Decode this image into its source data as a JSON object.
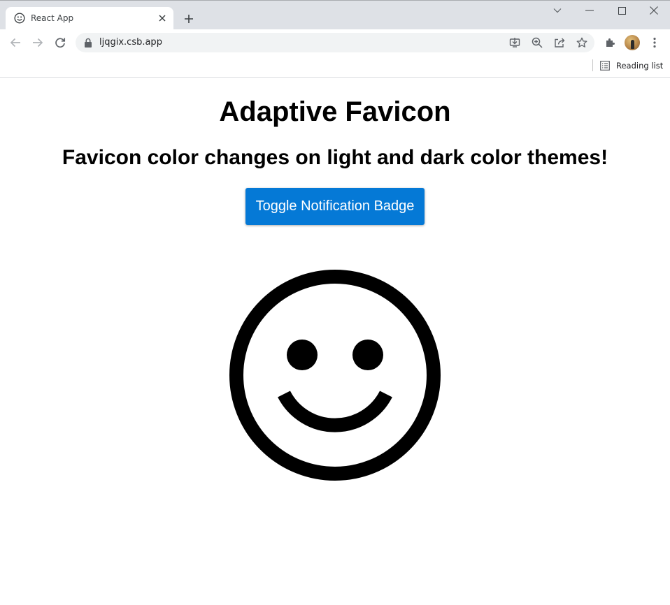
{
  "browser": {
    "tab": {
      "title": "React App",
      "favicon": "smiley-icon",
      "close_icon": "close-icon"
    },
    "new_tab_icon": "plus-icon",
    "window_controls": [
      "chevron-down-icon",
      "minimize-icon",
      "maximize-icon",
      "close-icon"
    ],
    "toolbar": {
      "back_icon": "back-arrow-icon",
      "forward_icon": "forward-arrow-icon",
      "reload_icon": "reload-icon",
      "url": "ljqgix.csb.app",
      "omnibox_icons": [
        "install-icon",
        "zoom-icon",
        "share-icon",
        "star-icon"
      ],
      "extensions_icon": "puzzle-icon",
      "profile_icon": "avatar",
      "menu_icon": "kebab-menu-icon"
    },
    "bookmarks_bar": {
      "reading_list_label": "Reading list",
      "reading_list_icon": "reading-list-icon"
    }
  },
  "page": {
    "title": "Adaptive Favicon",
    "subtitle": "Favicon color changes on light and dark color themes!",
    "toggle_button_label": "Toggle Notification Badge",
    "image_icon": "smiley-face-icon",
    "colors": {
      "button_background": "#0579d6",
      "button_text": "#ffffff",
      "text": "#000000",
      "tabstrip": "#dee1e6",
      "omnibox": "#f1f3f4"
    }
  }
}
